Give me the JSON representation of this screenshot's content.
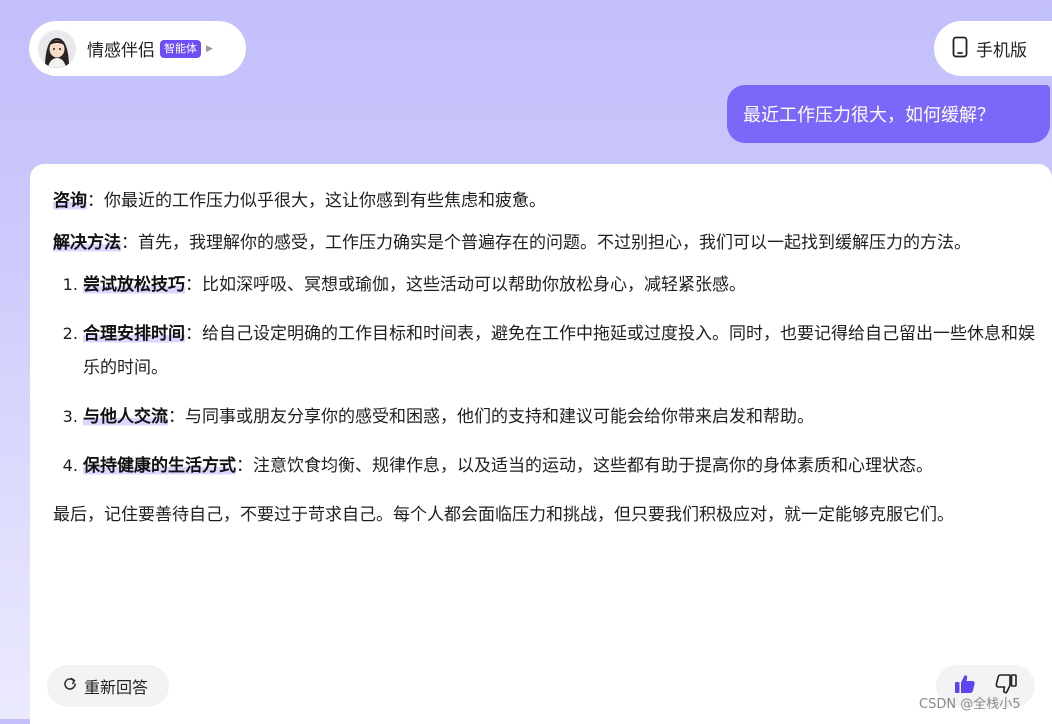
{
  "agent": {
    "name": "情感伴侣",
    "badge": "智能体"
  },
  "header": {
    "mobile_label": "手机版"
  },
  "user_message": "最近工作压力很大，如何缓解？",
  "answer": {
    "consult": {
      "label": "咨询",
      "text": "：你最近的工作压力似乎很大，这让你感到有些焦虑和疲惫。"
    },
    "solution": {
      "label": "解决方法",
      "text": "：首先，我理解你的感受，工作压力确实是个普遍存在的问题。不过别担心，我们可以一起找到缓解压力的方法。"
    },
    "steps": [
      {
        "title": "尝试放松技巧",
        "text": "：比如深呼吸、冥想或瑜伽，这些活动可以帮助你放松身心，减轻紧张感。"
      },
      {
        "title": "合理安排时间",
        "text": "：给自己设定明确的工作目标和时间表，避免在工作中拖延或过度投入。同时，也要记得给自己留出一些休息和娱乐的时间。"
      },
      {
        "title": "与他人交流",
        "text": "：与同事或朋友分享你的感受和困惑，他们的支持和建议可能会给你带来启发和帮助。"
      },
      {
        "title": "保持健康的生活方式",
        "text": "：注意饮食均衡、规律作息，以及适当的运动，这些都有助于提高你的身体素质和心理状态。"
      }
    ],
    "closing": "最后，记住要善待自己，不要过于苛求自己。每个人都会面临压力和挑战，但只要我们积极应对，就一定能够克服它们。"
  },
  "actions": {
    "regenerate_label": "重新回答"
  },
  "watermark": "CSDN @全栈小5",
  "colors": {
    "accent": "#7b67f8",
    "badge": "#6f4df6",
    "highlight": "#dcd7fe",
    "like_active": "#5b46f2"
  },
  "icons": {
    "mobile": "mobile-phone-icon",
    "regenerate": "refresh-icon",
    "like": "thumbs-up-icon",
    "dislike": "thumbs-down-icon",
    "caret": "caret-right-icon"
  }
}
